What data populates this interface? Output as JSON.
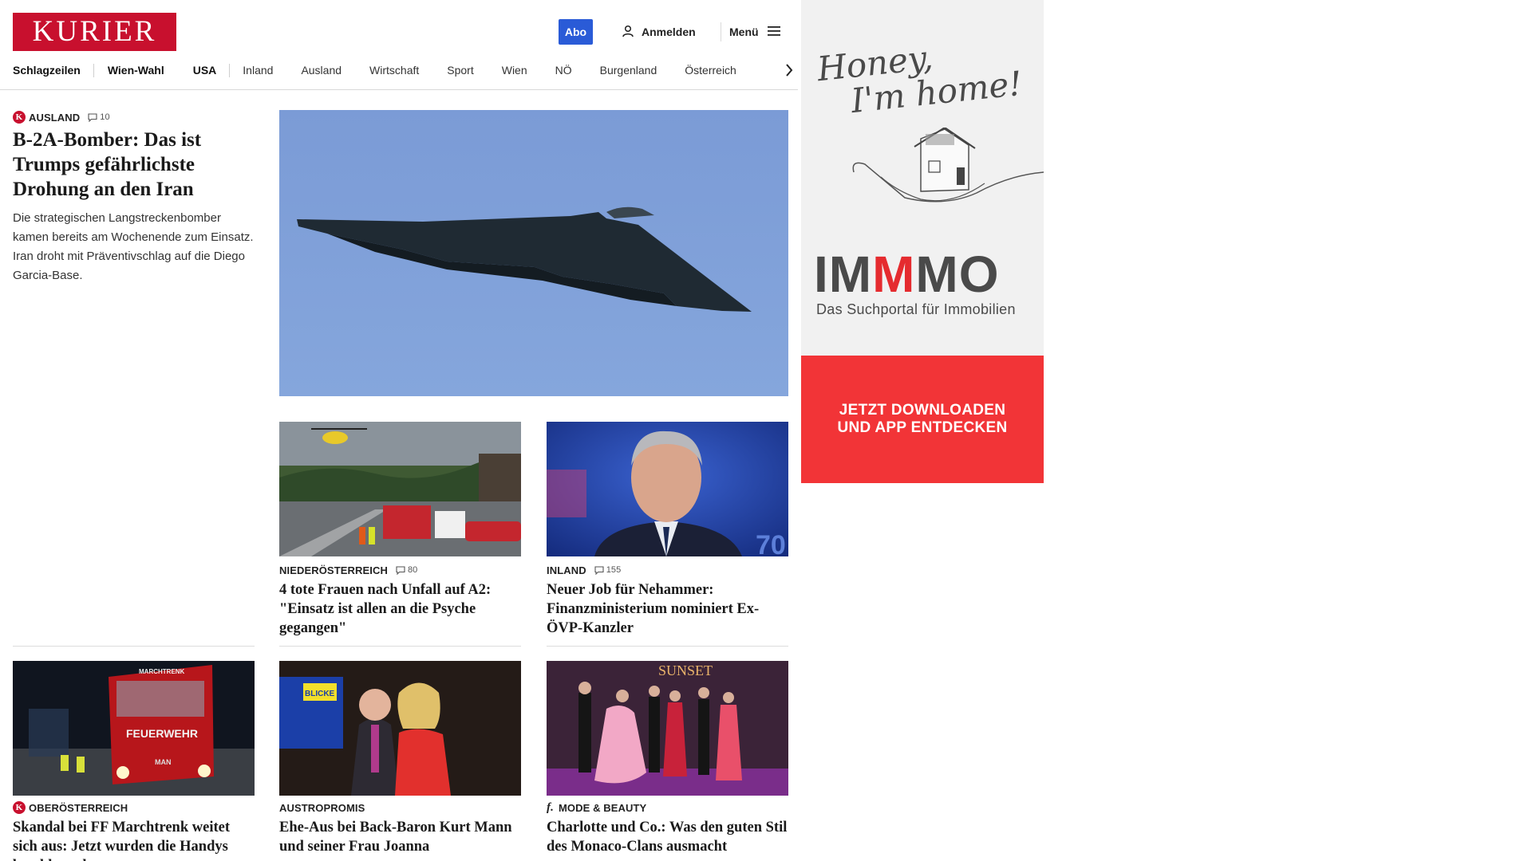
{
  "header": {
    "logo_text": "KURIER",
    "abo_label": "Abo",
    "login_label": "Anmelden",
    "menu_label": "Menü",
    "colors": {
      "brand": "#c8102e",
      "abo": "#2a5bd7"
    }
  },
  "nav": {
    "items": [
      "Schlagzeilen",
      "Wien-Wahl",
      "USA",
      "Inland",
      "Ausland",
      "Wirtschaft",
      "Sport",
      "Wien",
      "NÖ",
      "Burgenland",
      "Österreich"
    ]
  },
  "lead": {
    "kicker": "AUSLAND",
    "comments": "10",
    "headline": "B-2A-Bomber: Das ist Trumps gefährlichste Drohung an den Iran",
    "teaser": "Die strategischen Langstreckenbomber kamen bereits am Wochenende zum Einsatz. Iran droht mit Präventivschlag auf die Diego Garcia-Base."
  },
  "cards": [
    {
      "kicker": "NIEDERÖSTERREICH",
      "comments": "80",
      "headline": "4 tote Frauen nach Unfall auf A2: \"Einsatz ist allen an die Psyche gegangen\""
    },
    {
      "kicker": "INLAND",
      "comments": "155",
      "headline": "Neuer Job für Nehammer: Finanzministerium nominiert Ex-ÖVP-Kanzler"
    },
    {
      "kicker": "OBERÖSTERREICH",
      "headline": "Skandal bei FF Marchtrenk weitet sich aus: Jetzt wurden die Handys beschlagnahmt"
    },
    {
      "kicker": "AUSTROPROMIS",
      "headline": "Ehe-Aus bei Back-Baron Kurt Mann und seiner Frau Joanna"
    },
    {
      "kicker": "MODE & BEAUTY",
      "headline": "Charlotte und Co.: Was den guten Stil des Monaco-Clans ausmacht"
    }
  ],
  "images": {
    "photo_texts": [
      "FEUERWEHR",
      "MARCHTRENK",
      "MAN",
      "SUNSET",
      "70",
      "BLICKE"
    ]
  },
  "ad": {
    "script_line1": "Honey,",
    "script_line2": "I'm home!",
    "brand_a": "IM",
    "brand_b": "M",
    "brand_c": "MO",
    "tagline": "Das Suchportal für Immobilien",
    "cta_line1": "JETZT DOWNLOADEN",
    "cta_line2": "UND APP ENTDECKEN",
    "colors": {
      "accent": "#f23437",
      "text": "#4a4a4a"
    }
  }
}
